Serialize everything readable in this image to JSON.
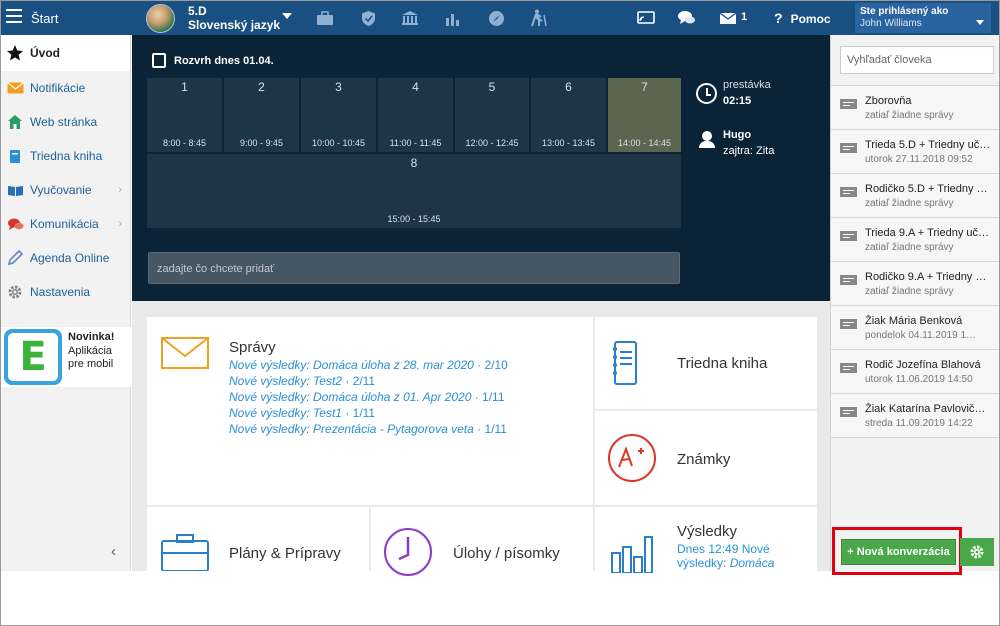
{
  "topbar": {
    "start_label": "Štart",
    "class_code": "5.D",
    "subject": "Slovenský jazyk",
    "messages_count": "1",
    "help_label": "Pomoc",
    "logged_as_label": "Ste prihlásený ako",
    "user_name": "John Williams"
  },
  "sidebar": {
    "items": [
      {
        "label": "Úvod",
        "icon": "star-icon"
      },
      {
        "label": "Notifikácie",
        "icon": "envelope-icon"
      },
      {
        "label": "Web stránka",
        "icon": "home-icon"
      },
      {
        "label": "Triedna kniha",
        "icon": "book-icon"
      },
      {
        "label": "Vyučovanie",
        "icon": "open-book-icon"
      },
      {
        "label": "Komunikácia",
        "icon": "chat-icon"
      },
      {
        "label": "Agenda Online",
        "icon": "pen-icon"
      },
      {
        "label": "Nastavenia",
        "icon": "gear-icon"
      }
    ],
    "promo_title": "Novinka!",
    "promo_text": "Aplikácia pre mobil",
    "promo_logo_letter": "E"
  },
  "schedule": {
    "title": "Rozvrh dnes 01.04.",
    "lessons": [
      {
        "num": "1",
        "time": "8:00 - 8:45"
      },
      {
        "num": "2",
        "time": "9:00 - 9:45"
      },
      {
        "num": "3",
        "time": "10:00 - 10:45"
      },
      {
        "num": "4",
        "time": "11:00 - 11:45"
      },
      {
        "num": "5",
        "time": "12:00 - 12:45"
      },
      {
        "num": "6",
        "time": "13:00 - 13:45"
      },
      {
        "num": "7",
        "time": "14:00 - 14:45"
      },
      {
        "num": "8",
        "time": "15:00 - 15:45"
      }
    ],
    "break_label": "prestávka",
    "break_time": "02:15",
    "duty_name": "Hugo",
    "duty_tomorrow": "zajtra: Zita",
    "add_placeholder": "zadajte čo chcete pridať"
  },
  "dashboard": {
    "messages": {
      "title": "Správy",
      "lines": [
        {
          "prefix": "Nové výsledky:",
          "item": "Domáca úloha z 28. mar 2020",
          "count": "· 2/10"
        },
        {
          "prefix": "Nové výsledky:",
          "item": "Test2",
          "count": "· 2/11"
        },
        {
          "prefix": "Nové výsledky:",
          "item": "Domáca úloha z 01. Apr 2020",
          "count": "· 1/11"
        },
        {
          "prefix": "Nové výsledky:",
          "item": "Test1",
          "count": "· 1/11"
        },
        {
          "prefix": "Nové výsledky:",
          "item": "Prezentácia - Pytagorova veta",
          "count": "· 1/11"
        }
      ]
    },
    "class_book_title": "Triedna kniha",
    "grades_title": "Známky",
    "plans_title": "Plány & Prípravy",
    "tasks_title": "Úlohy / písomky",
    "results_title": "Výsledky",
    "results_text": "Dnes 12:49 Nové výsledky:",
    "results_item": "Domáca"
  },
  "conversations": {
    "search_placeholder": "Vyhľadať človeka",
    "items": [
      {
        "name": "Zborovňa",
        "sub": "zatiaľ žiadne správy"
      },
      {
        "name": "Trieda 5.D + Triedny uč…",
        "sub": "utorok 27.11.2018 09:52"
      },
      {
        "name": "Rodičko 5.D + Triedny …",
        "sub": "zatiaľ žiadne správy"
      },
      {
        "name": "Trieda 9.A + Triedny uč…",
        "sub": "zatiaľ žiadne správy"
      },
      {
        "name": "Rodičko 9.A + Triedny …",
        "sub": "zatiaľ žiadne správy"
      },
      {
        "name": "Žiak Mária Benková",
        "sub": "pondelok 04.11.2019 1…"
      },
      {
        "name": "Rodič Jozefína Blahová",
        "sub": "utorok 11.06.2019 14:50"
      },
      {
        "name": "Žiak Katarína Pavlovič…",
        "sub": "streda 11.09.2019 14:22"
      }
    ],
    "new_button": "+ Nová konverzácia"
  },
  "colors": {
    "topbar": "#1a4f81",
    "dark": "#0a2337",
    "accent_green": "#4aa84a",
    "link": "#2a8fd6",
    "highlight": "#e00010"
  }
}
